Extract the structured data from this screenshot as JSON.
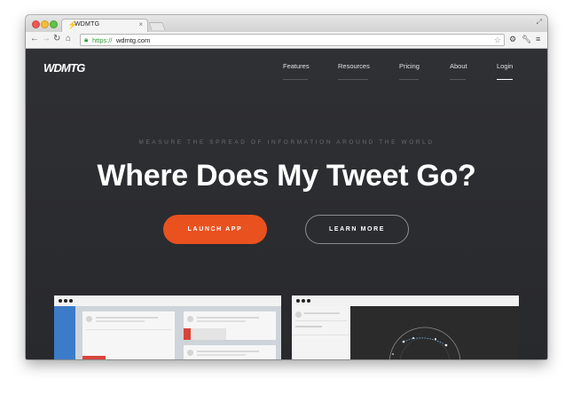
{
  "browser": {
    "tab_title": "WDMTG",
    "tab_icon": "bolt-icon",
    "close_glyph": "×",
    "url_scheme": "https://",
    "url_host": "wdmtg.com"
  },
  "site": {
    "logo": "WDMTG",
    "nav": [
      {
        "label": "Features"
      },
      {
        "label": "Resources"
      },
      {
        "label": "Pricing"
      },
      {
        "label": "About"
      },
      {
        "label": "Login",
        "active": true
      }
    ],
    "kicker": "MEASURE THE SPREAD OF INFORMATION AROUND THE WORLD",
    "headline": "Where Does My Tweet Go?",
    "cta_primary": "LAUNCH APP",
    "cta_secondary": "LEARN MORE"
  },
  "colors": {
    "accent": "#e9511f",
    "page_bg": "#2d2e31",
    "secure_green": "#2f9a36"
  }
}
